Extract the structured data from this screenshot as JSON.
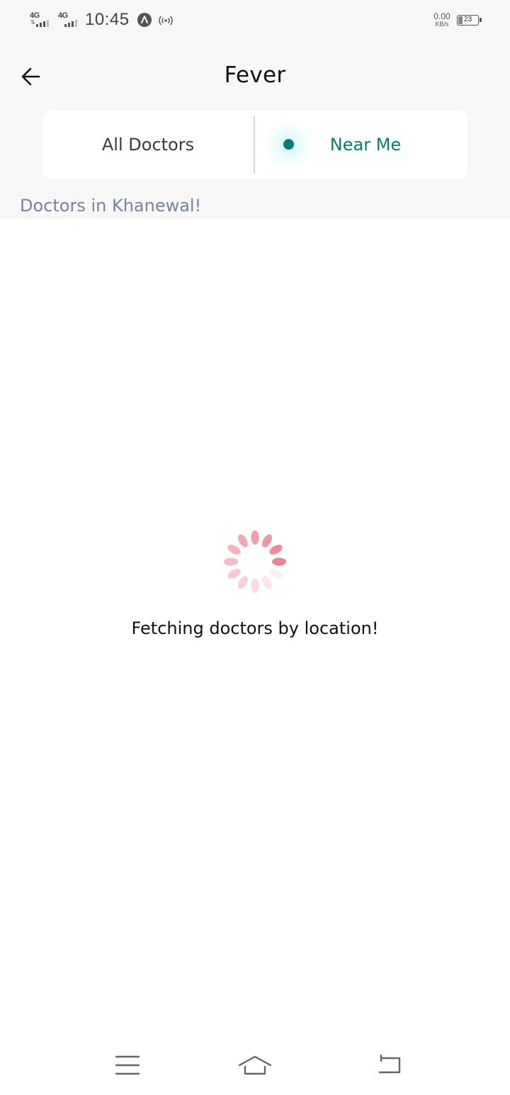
{
  "status_bar": {
    "sim1_network": "4G",
    "sim2_network": "4G",
    "time": "10:45",
    "speed_value": "0.00",
    "speed_unit": "KB/s",
    "battery_level": "23",
    "battery_fraction": 0.23,
    "icons": [
      "signal-icon",
      "signal-icon",
      "app-notification-icon",
      "hotspot-icon",
      "battery-icon"
    ]
  },
  "header": {
    "back_icon": "arrow-left-icon",
    "title": "Fever"
  },
  "tabs": [
    {
      "label": "All Doctors",
      "selected": false
    },
    {
      "label": "Near Me",
      "selected": true
    }
  ],
  "location_heading": "Doctors in Khanewal!",
  "loader": {
    "icon": "loading-spinner-icon",
    "message": "Fetching doctors by location!"
  },
  "colors": {
    "accent": "#0b7a76",
    "heading_muted": "#77849a",
    "spinner": "#f07a91",
    "header_background": "#f7f7f7"
  },
  "nav_bar": {
    "icons": [
      "menu-icon",
      "home-icon",
      "back-icon"
    ]
  }
}
